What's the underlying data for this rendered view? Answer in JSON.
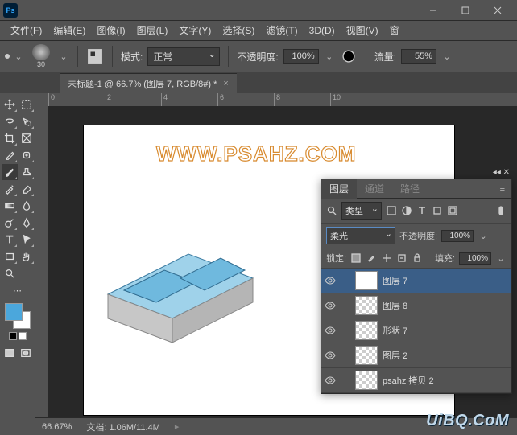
{
  "app": {
    "logo": "Ps"
  },
  "menu": [
    "文件(F)",
    "编辑(E)",
    "图像(I)",
    "图层(L)",
    "文字(Y)",
    "选择(S)",
    "滤镜(T)",
    "3D(D)",
    "视图(V)",
    "窗"
  ],
  "options": {
    "brush_size": "30",
    "mode_label": "模式:",
    "mode_value": "正常",
    "opacity_label": "不透明度:",
    "opacity_value": "100%",
    "flow_label": "流量:",
    "flow_value": "55%"
  },
  "document": {
    "tab_title": "未标题-1 @ 66.7% (图层 7, RGB/8#) *",
    "canvas_watermark": "WWW.PSAHZ.COM"
  },
  "ruler_marks": [
    "0",
    "2",
    "4",
    "6",
    "8",
    "10"
  ],
  "panel": {
    "tabs": [
      "图层",
      "通道",
      "路径"
    ],
    "filter_label": "类型",
    "blend_mode": "柔光",
    "opacity_label": "不透明度:",
    "opacity_value": "100%",
    "lock_label": "锁定:",
    "fill_label": "填充:",
    "fill_value": "100%",
    "layers": [
      {
        "name": "图层 7",
        "selected": true,
        "thumb": "plain"
      },
      {
        "name": "图层 8",
        "selected": false,
        "thumb": "checker"
      },
      {
        "name": "形状 7",
        "selected": false,
        "thumb": "checker"
      },
      {
        "name": "图层 2",
        "selected": false,
        "thumb": "checker"
      },
      {
        "name": "psahz 拷贝 2",
        "selected": false,
        "thumb": "checker"
      }
    ]
  },
  "status": {
    "zoom": "66.67%",
    "doc_label": "文档:",
    "doc_info": "1.06M/11.4M"
  },
  "watermark": "UiBQ.CoM",
  "colors": {
    "foreground": "#4ba7dc",
    "background": "#ffffff",
    "accent": "#31a8ff"
  }
}
